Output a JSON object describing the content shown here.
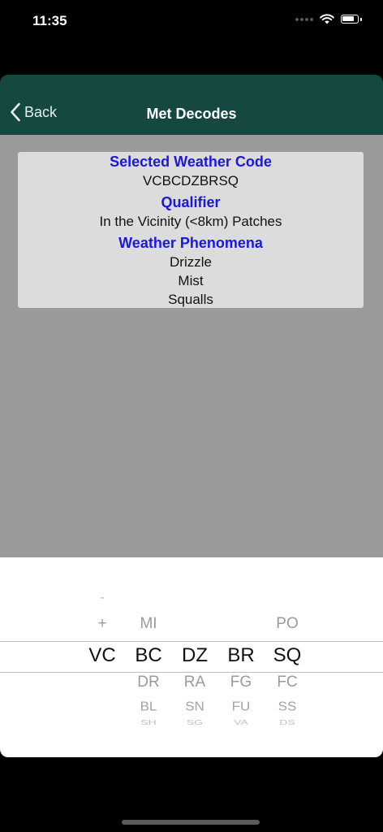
{
  "status_bar": {
    "time": "11:35"
  },
  "nav": {
    "back_label": "Back",
    "title": "Met Decodes"
  },
  "card": {
    "selected_heading": "Selected Weather Code",
    "selected_code": "VCBCDZBRSQ",
    "qualifier_heading": "Qualifier",
    "qualifier_value": "In the Vicinity (<8km) Patches",
    "phenomena_heading": "Weather Phenomena",
    "phenomena": [
      "Drizzle",
      "Mist",
      "Squalls"
    ]
  },
  "picker": {
    "columns": [
      {
        "name": "qualifier",
        "above": [
          "-",
          "+"
        ],
        "selected": "VC",
        "below": []
      },
      {
        "name": "descriptor",
        "above": [
          "MI"
        ],
        "selected": "BC",
        "below": [
          "DR",
          "BL",
          "SH"
        ]
      },
      {
        "name": "precipitation",
        "above": [],
        "selected": "DZ",
        "below": [
          "RA",
          "SN",
          "SG"
        ]
      },
      {
        "name": "obscuration",
        "above": [],
        "selected": "BR",
        "below": [
          "FG",
          "FU",
          "VA"
        ]
      },
      {
        "name": "other",
        "above": [
          "PO"
        ],
        "selected": "SQ",
        "below": [
          "FC",
          "SS",
          "DS"
        ]
      }
    ]
  },
  "colors": {
    "nav_background": "#144840",
    "heading_blue": "#1a17e0",
    "content_gray": "#9a9a9a"
  }
}
